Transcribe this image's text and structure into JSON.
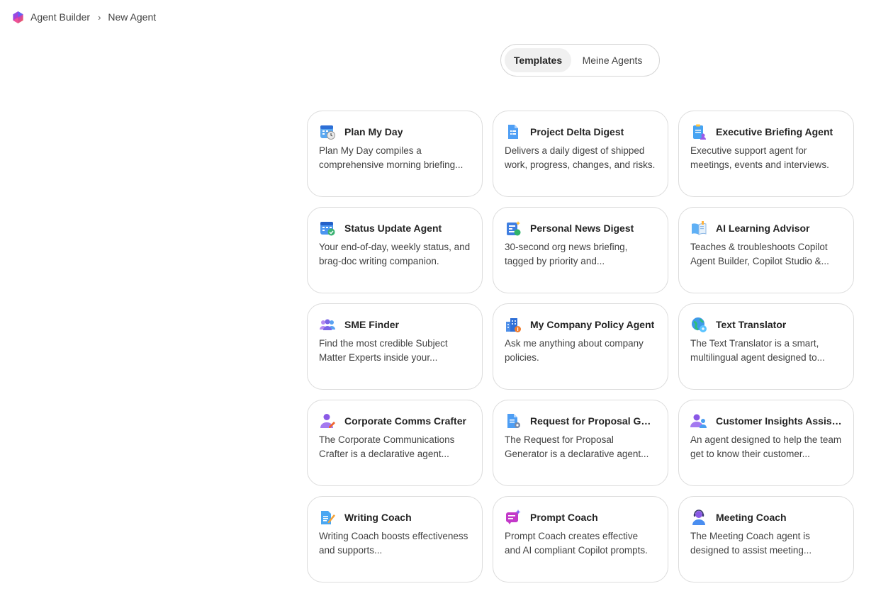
{
  "breadcrumb": {
    "app": "Agent Builder",
    "current": "New Agent"
  },
  "tabs": {
    "templates": "Templates",
    "my_agents": "Meine Agents"
  },
  "cards": [
    {
      "title": "Plan My Day",
      "desc": "Plan My Day compiles a comprehensive morning briefing...",
      "icon": "calendar-clock-icon"
    },
    {
      "title": "Project Delta Digest",
      "desc": "Delivers a daily digest of shipped work, progress, changes, and risks.",
      "icon": "document-list-icon"
    },
    {
      "title": "Executive Briefing Agent",
      "desc": "Executive support agent for meetings, events and interviews.",
      "icon": "clipboard-person-icon"
    },
    {
      "title": "Status Update Agent",
      "desc": "Your end-of-day, weekly status, and brag-doc writing companion.",
      "icon": "calendar-check-icon"
    },
    {
      "title": "Personal News Digest",
      "desc": "30-second org news briefing, tagged by priority and...",
      "icon": "news-sparkle-icon"
    },
    {
      "title": "AI Learning Advisor",
      "desc": "Teaches & troubleshoots Copilot Agent Builder, Copilot Studio &...",
      "icon": "open-book-icon"
    },
    {
      "title": "SME Finder",
      "desc": "Find the most credible Subject Matter Experts inside your...",
      "icon": "people-group-icon"
    },
    {
      "title": "My Company Policy Agent",
      "desc": "Ask me anything about company policies.",
      "icon": "building-info-icon"
    },
    {
      "title": "Text Translator",
      "desc": "The Text Translator is a smart, multilingual agent designed to...",
      "icon": "globe-translate-icon"
    },
    {
      "title": "Corporate Comms Crafter",
      "desc": "The Corporate Communications Crafter is a declarative agent...",
      "icon": "person-edit-icon"
    },
    {
      "title": "Request for Proposal Gen...",
      "desc": "The Request for Proposal Generator is a declarative agent...",
      "icon": "document-gear-icon"
    },
    {
      "title": "Customer Insights Assistant",
      "desc": "An agent designed to help the team get to know their customer...",
      "icon": "person-pair-icon"
    },
    {
      "title": "Writing Coach",
      "desc": "Writing Coach boosts effectiveness and supports...",
      "icon": "document-pen-icon"
    },
    {
      "title": "Prompt Coach",
      "desc": "Prompt Coach creates effective and AI compliant Copilot prompts.",
      "icon": "chat-sparkle-icon"
    },
    {
      "title": "Meeting Coach",
      "desc": "The Meeting Coach agent is designed to assist meeting...",
      "icon": "person-headset-icon"
    }
  ]
}
